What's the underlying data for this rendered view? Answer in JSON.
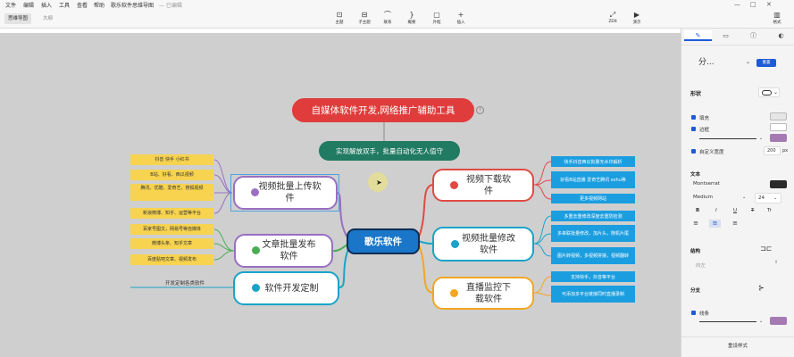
{
  "menu": [
    "文件",
    "编辑",
    "插入",
    "工具",
    "查看",
    "帮助",
    "歌乐软件思维导图",
    "— 已编辑"
  ],
  "tabs": {
    "active": "思维导图",
    "inactive": "大纲"
  },
  "toolbar": [
    {
      "icon": "topic-icon",
      "label": "主题",
      "glyph": "⊡"
    },
    {
      "icon": "subtopic-icon",
      "label": "子主题",
      "glyph": "⊟"
    },
    {
      "icon": "relation-icon",
      "label": "联系",
      "glyph": "⌒"
    },
    {
      "icon": "summary-icon",
      "label": "概要",
      "glyph": "}"
    },
    {
      "icon": "boundary-icon",
      "label": "外框",
      "glyph": "▢"
    },
    {
      "icon": "insert-icon",
      "label": "插入",
      "glyph": "+"
    }
  ],
  "toolbar_right": [
    {
      "icon": "zen-icon",
      "label": "ZEN",
      "glyph": "⤢"
    },
    {
      "icon": "present-icon",
      "label": "演示",
      "glyph": "▶"
    }
  ],
  "panel": {
    "format_button": "格式",
    "structure_value": "分...",
    "reset_label": "重置",
    "shape_section": "形状",
    "fill_label": "填充",
    "border_label": "边框",
    "custom_width_label": "自定义宽度",
    "width_value": "200",
    "width_unit": "px",
    "text_section": "文本",
    "font_value": "Montserrat",
    "weight_value": "Medium",
    "size_value": "24",
    "bold": "B",
    "italic": "I",
    "underline": "U",
    "strike": "T",
    "case": "Tr",
    "structure_section": "结构",
    "layout_value": "向左",
    "branch_section": "分支",
    "line_label": "线条",
    "reset_style": "重设样式",
    "colors": {
      "border": "#a57ab3",
      "text": "#2b2b2b",
      "line": "#a57ab3",
      "accent": "#1e5bd8"
    }
  },
  "mindmap": {
    "main": "自媒体软件开发,网络推广辅助工具",
    "sub": "实现解放双手，批量自动化无人值守",
    "center": "歌乐软件",
    "branches": [
      {
        "text": "视频批量上传软件",
        "color": "#9a6fc1"
      },
      {
        "text": "文章批量发布软件",
        "color": "#4aae55"
      },
      {
        "text": "软件开发定制",
        "color": "#1aa3c8"
      },
      {
        "text": "视频下载软件",
        "color": "#e04a43"
      },
      {
        "text": "视频批量修改软件",
        "color": "#1aa3c8"
      },
      {
        "text": "直播监控下载软件",
        "color": "#f2a623"
      }
    ],
    "left_notes": [
      "抖音 快手 小红书",
      "B站、好看、西瓜视频",
      "腾讯、优酷、爱奇艺、搜狐视频",
      "新浪微博、知乎、运营等平台",
      "百家号图文，网易号等自媒体",
      "微博头条、知乎文章",
      "百度贴吧文章、视频发布"
    ],
    "custom_note": "开发定制各类软件",
    "right_notes": [
      "快手抖音西瓜批量无水印解析",
      "好看B站直播 爱奇艺腾讯 sohu等",
      "更多视频网站",
      "多重去重修改深度去重防检测",
      "多串联批量修改，加片头，随机片尾",
      "图片转视频，多视频拼接，视频翻转",
      "支持快手，抖音等平台",
      "可添加多平台链接同时直播录制"
    ]
  }
}
